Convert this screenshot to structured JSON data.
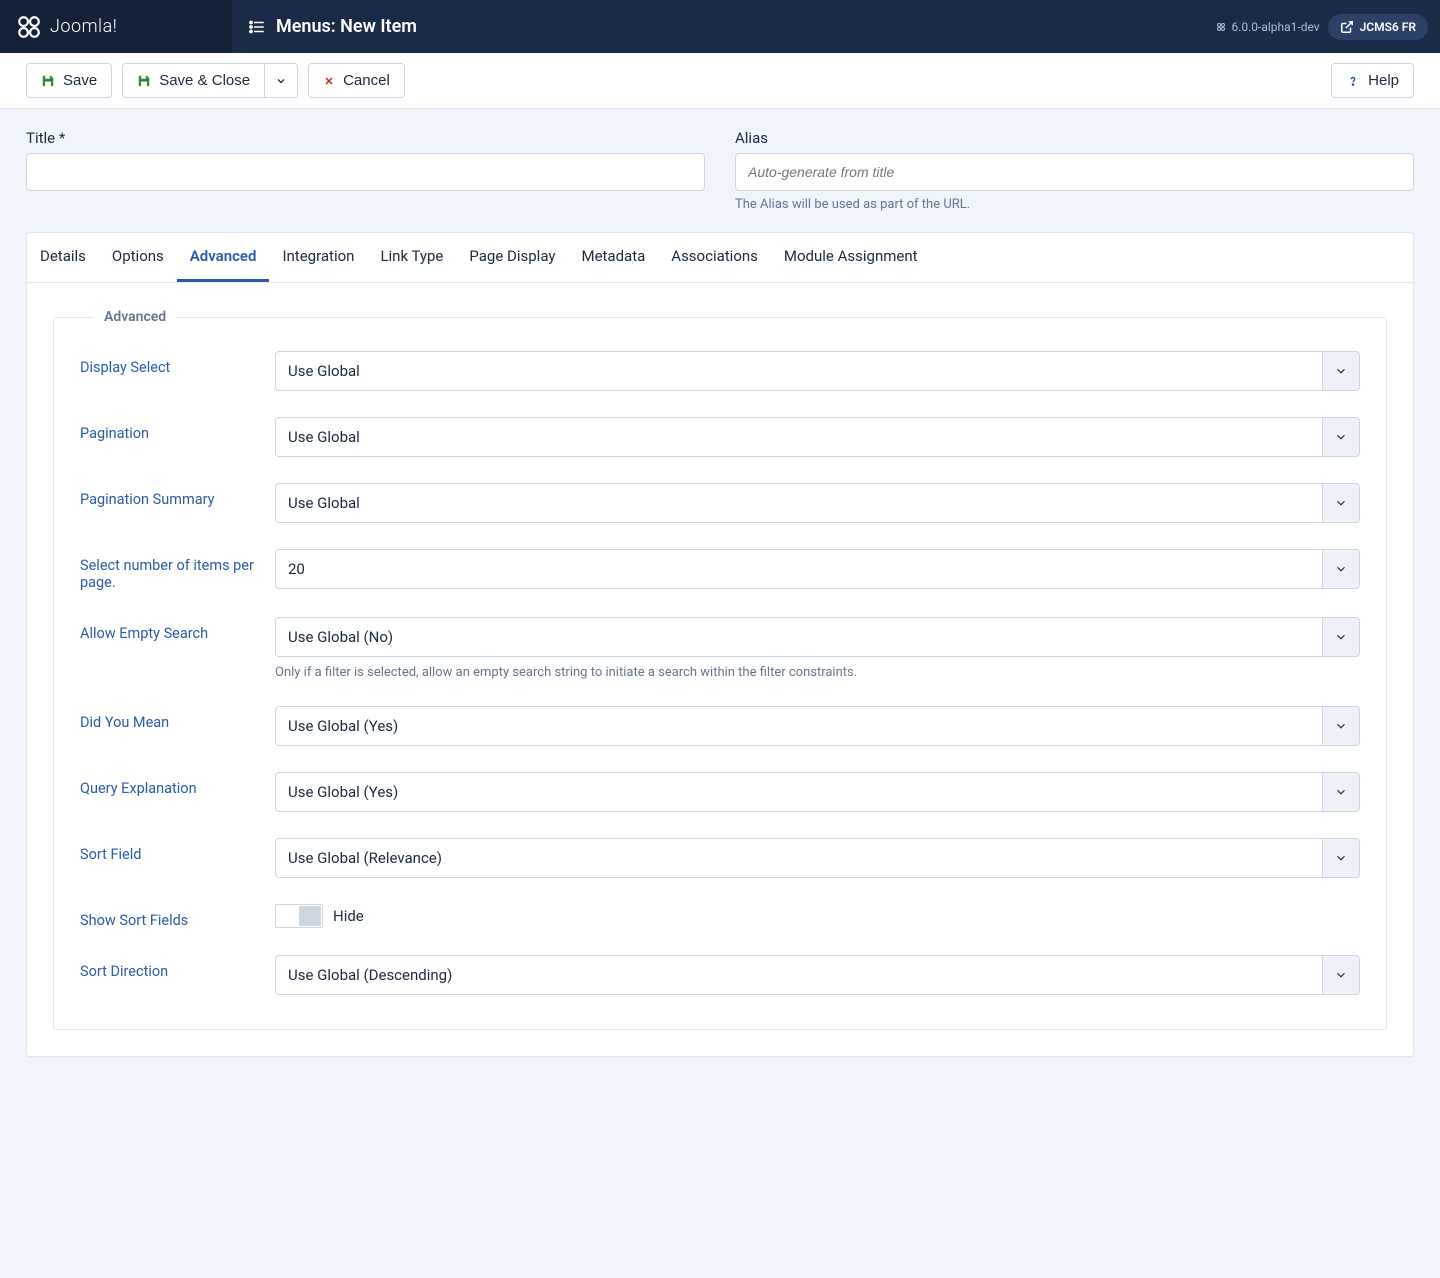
{
  "brand": "Joomla!",
  "page_title": "Menus: New Item",
  "version": "6.0.0-alpha1-dev",
  "user": "JCMS6 FR",
  "toolbar": {
    "save": "Save",
    "save_close": "Save & Close",
    "cancel": "Cancel",
    "help": "Help"
  },
  "form": {
    "title_label": "Title *",
    "alias_label": "Alias",
    "alias_placeholder": "Auto-generate from title",
    "alias_help": "The Alias will be used as part of the URL."
  },
  "tabs": [
    "Details",
    "Options",
    "Advanced",
    "Integration",
    "Link Type",
    "Page Display",
    "Metadata",
    "Associations",
    "Module Assignment"
  ],
  "active_tab": 2,
  "fieldset_legend": "Advanced",
  "fields": {
    "display_select": {
      "label": "Display Select",
      "value": "Use Global"
    },
    "pagination": {
      "label": "Pagination",
      "value": "Use Global"
    },
    "pag_summary": {
      "label": "Pagination Summary",
      "value": "Use Global"
    },
    "items_per_page": {
      "label": "Select number of items per page.",
      "value": "20"
    },
    "allow_empty": {
      "label": "Allow Empty Search",
      "value": "Use Global (No)",
      "desc": "Only if a filter is selected, allow an empty search string to initiate a search within the filter constraints."
    },
    "did_you_mean": {
      "label": "Did You Mean",
      "value": "Use Global (Yes)"
    },
    "query_expl": {
      "label": "Query Explanation",
      "value": "Use Global (Yes)"
    },
    "sort_field": {
      "label": "Sort Field",
      "value": "Use Global (Relevance)"
    },
    "show_sort": {
      "label": "Show Sort Fields",
      "value": "Hide"
    },
    "sort_dir": {
      "label": "Sort Direction",
      "value": "Use Global (Descending)"
    }
  }
}
